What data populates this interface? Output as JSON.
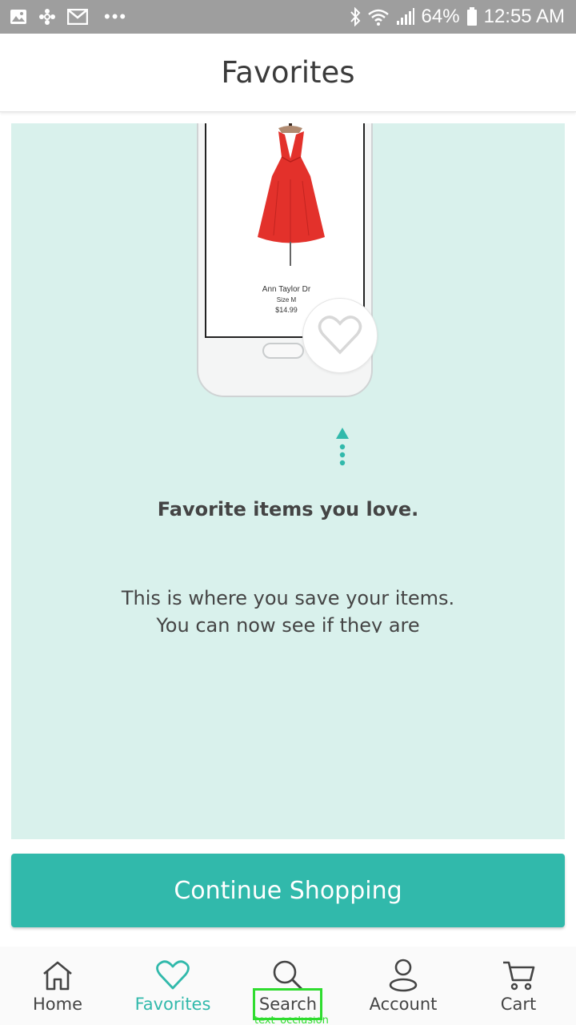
{
  "status_bar": {
    "battery": "64%",
    "time": "12:55 AM",
    "left_icons": [
      "gallery-icon",
      "pinwheel-icon",
      "gmail-icon",
      "more-dots-icon"
    ],
    "right_icons": [
      "bluetooth-icon",
      "wifi-icon",
      "signal-icon",
      "battery-icon"
    ]
  },
  "header": {
    "title": "Favorites"
  },
  "promo": {
    "product": {
      "name": "Ann Taylor Dr",
      "size": "Size M",
      "price": "$14.99"
    },
    "headline": "Favorite items you love.",
    "body_line1": "This is where you save your items.",
    "body_line2": "You can now see if they are"
  },
  "continue_button": {
    "label": "Continue Shopping"
  },
  "nav": {
    "items": [
      {
        "label": "Home",
        "icon": "home-icon"
      },
      {
        "label": "Favorites",
        "icon": "heart-icon",
        "active": true
      },
      {
        "label": "Search",
        "icon": "search-icon"
      },
      {
        "label": "Account",
        "icon": "account-icon"
      },
      {
        "label": "Cart",
        "icon": "cart-icon"
      }
    ]
  },
  "overlay": {
    "label": "text_occlusion"
  },
  "colors": {
    "accent": "#31b9ab",
    "card_bg": "#d9f1ec",
    "status_bar": "#9e9e9e",
    "highlight": "#2fdc2f"
  }
}
